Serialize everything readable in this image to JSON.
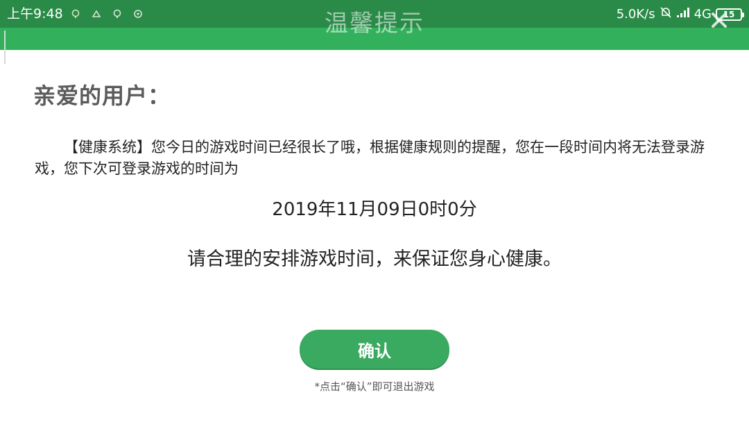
{
  "status_bar": {
    "time": "上午9:48",
    "network_speed": "5.0K/s",
    "network_type": "4G",
    "battery_level": "15",
    "notification_icons": [
      "notification-icon",
      "notification-icon",
      "notification-icon",
      "notification-icon"
    ],
    "colors": {
      "bar": "#2a8a48"
    }
  },
  "dialog": {
    "title": "温馨提示",
    "greeting": "亲爱的用户：",
    "message": "【健康系统】您今日的游戏时间已经很长了哦，根据健康规则的提醒，您在一段时间内将无法登录游戏，您下次可登录游戏的时间为",
    "unlock_time": "2019年11月09日0时0分",
    "advice": "请合理的安排游戏时间，来保证您身心健康。",
    "confirm_label": "确认",
    "hint": "*点击“确认”即可退出游戏",
    "colors": {
      "header": "#33b05c",
      "button": "#3aaa60"
    }
  }
}
